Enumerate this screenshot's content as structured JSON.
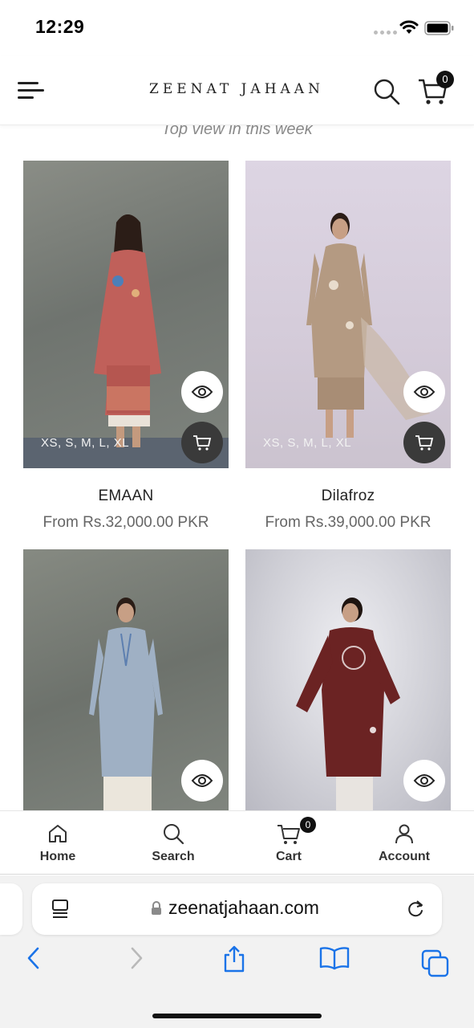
{
  "status_bar": {
    "time": "12:29"
  },
  "header": {
    "brand": "ZEENAT JAHAAN",
    "cart_count": "0"
  },
  "section": {
    "subtitle": "Top view in this week"
  },
  "products": [
    {
      "name": "EMAAN",
      "price": "From Rs.32,000.00 PKR",
      "sizes": "XS, S, M, L, XL",
      "outfit_color": "#c0605a",
      "bg_color": "#7d817c"
    },
    {
      "name": "Dilafroz",
      "price": "From Rs.39,000.00 PKR",
      "sizes": "XS, S, M, L, XL",
      "outfit_color": "#b49a82",
      "bg_color": "#d9d1df"
    },
    {
      "name": "",
      "price": "",
      "sizes": "",
      "outfit_color": "#9fb0c4",
      "bg_color": "#7a7f78"
    },
    {
      "name": "",
      "price": "",
      "sizes": "",
      "outfit_color": "#6b2323",
      "bg_color": "#d3d3d8"
    }
  ],
  "bottom_nav": {
    "items": [
      {
        "label": "Home",
        "icon": "home-icon"
      },
      {
        "label": "Search",
        "icon": "search-icon"
      },
      {
        "label": "Cart",
        "icon": "cart-icon"
      },
      {
        "label": "Account",
        "icon": "account-icon"
      }
    ],
    "cart_count": "0"
  },
  "browser": {
    "url": "zeenatjahaan.com",
    "toolbar": [
      "back-icon",
      "forward-icon",
      "share-icon",
      "bookmarks-icon",
      "tabs-icon"
    ]
  },
  "colors": {
    "accent": "#1a73e8",
    "dark": "#111111"
  }
}
